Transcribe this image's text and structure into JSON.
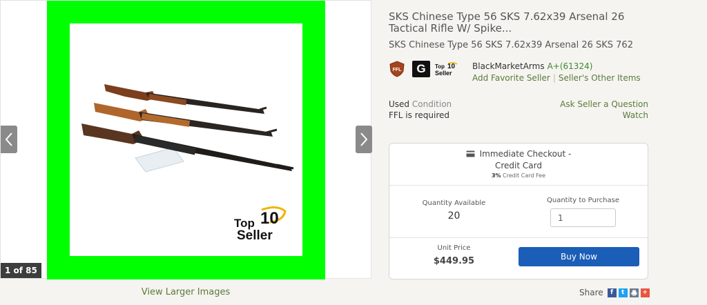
{
  "gallery": {
    "counter": "1 of 85",
    "view_larger": "View Larger Images",
    "watermark_top": "Top",
    "watermark_num": "10",
    "watermark_seller": "Seller"
  },
  "listing": {
    "title": "SKS Chinese Type 56 SKS 7.62x39 Arsenal 26 Tactical Rifle W/ Spike...",
    "subtitle": "SKS Chinese Type 56 SKS 7.62x39 Arsenal 26 SKS 762"
  },
  "badges": {
    "ffl": "FFL",
    "g": "G",
    "top10_top": "Top",
    "top10_num": "10",
    "top10_seller": "Seller"
  },
  "seller": {
    "name": "BlackMarketArms",
    "rating": "A+(61324)",
    "add_favorite": "Add Favorite Seller",
    "separator": "|",
    "other_items": "Seller's Other Items"
  },
  "condition": {
    "value": "Used",
    "label": "Condition",
    "ffl_required": "FFL is required",
    "ask_question": "Ask Seller a Question",
    "watch": "Watch"
  },
  "purchase": {
    "checkout_line1": "Immediate Checkout -",
    "checkout_line2": "Credit Card",
    "fee_percent": "3%",
    "fee_label": "Credit Card Fee",
    "qty_available_label": "Quantity Available",
    "qty_available": "20",
    "qty_purchase_label": "Quantity to Purchase",
    "qty_purchase_value": "1",
    "unit_price_label": "Unit Price",
    "unit_price": "$449.95",
    "buy_now": "Buy Now"
  },
  "share": {
    "label": "Share",
    "icons": [
      "facebook-icon",
      "twitter-icon",
      "print-icon",
      "plus-icon"
    ],
    "facebook_glyph": "f",
    "twitter_glyph": "t",
    "plus_glyph": "+",
    "colors": {
      "facebook": "#3b5998",
      "twitter": "#1da1f2",
      "print": "#6b7b8c",
      "plus": "#e8563f"
    }
  },
  "colors": {
    "accent_link": "#5a7a3a",
    "rating": "#3c8a2e",
    "buy_button": "#1a5eb8",
    "frame_green": "#00ff00"
  }
}
